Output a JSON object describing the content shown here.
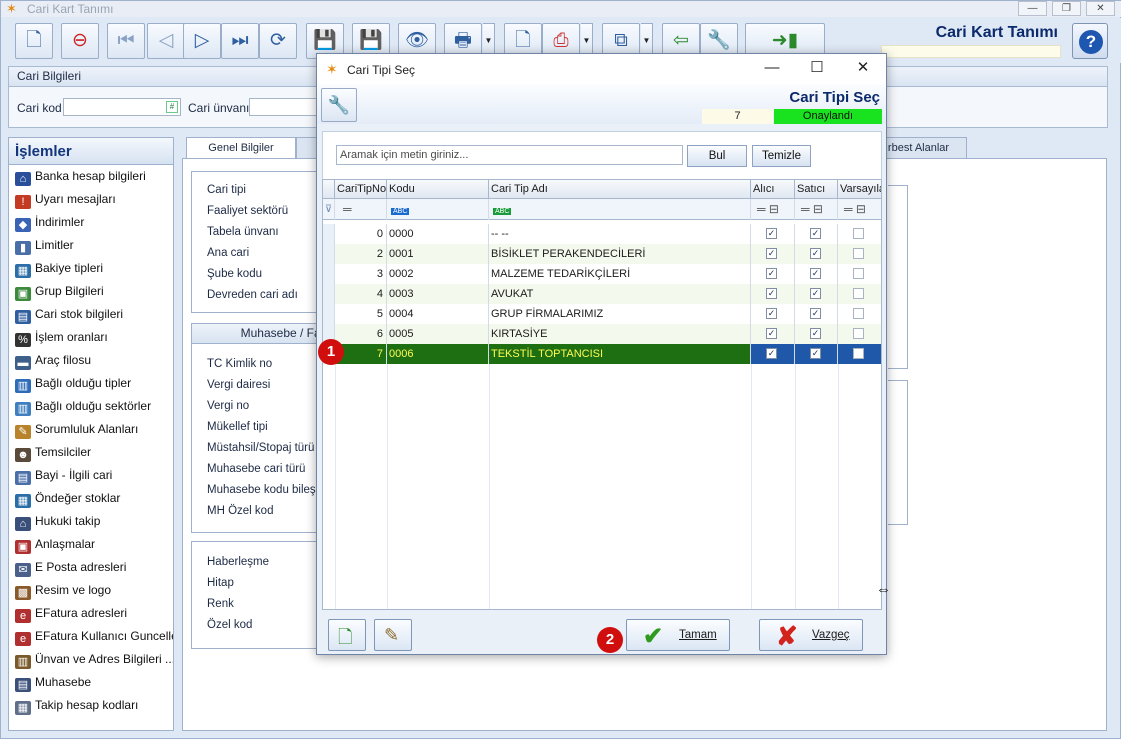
{
  "window": {
    "title": "Cari Kart Tanımı",
    "heading": "Cari Kart Tanımı"
  },
  "cari_bilgileri": {
    "group": "Cari Bilgileri",
    "kod_label": "Cari kod",
    "unvan_label": "Cari ünvanı"
  },
  "sidebar": {
    "title": "İşlemler",
    "items": [
      {
        "label": "Banka hesap bilgileri",
        "icon": "bank-icon"
      },
      {
        "label": "Uyarı mesajları",
        "icon": "warning-icon"
      },
      {
        "label": "İndirimler",
        "icon": "discount-icon"
      },
      {
        "label": "Limitler",
        "icon": "limit-icon"
      },
      {
        "label": "Bakiye tipleri",
        "icon": "calendar-icon"
      },
      {
        "label": "Grup Bilgileri",
        "icon": "group-icon"
      },
      {
        "label": "Cari stok bilgileri",
        "icon": "stock-icon"
      },
      {
        "label": "İşlem oranları",
        "icon": "percent-icon"
      },
      {
        "label": "Araç filosu",
        "icon": "vehicle-icon"
      },
      {
        "label": "Bağlı olduğu tipler",
        "icon": "type-icon"
      },
      {
        "label": "Bağlı olduğu sektörler",
        "icon": "sector-icon"
      },
      {
        "label": "Sorumluluk Alanları",
        "icon": "responsibility-icon"
      },
      {
        "label": "Temsilciler",
        "icon": "person-icon"
      },
      {
        "label": "Bayi - İlgili cari",
        "icon": "dealer-icon"
      },
      {
        "label": "Öndeğer stoklar",
        "icon": "default-stock-icon"
      },
      {
        "label": "Hukuki takip",
        "icon": "law-icon"
      },
      {
        "label": "Anlaşmalar",
        "icon": "agreement-icon"
      },
      {
        "label": "E Posta adresleri",
        "icon": "mail-icon"
      },
      {
        "label": "Resim ve logo",
        "icon": "image-icon"
      },
      {
        "label": "EFatura adresleri",
        "icon": "einvoice-icon"
      },
      {
        "label": "EFatura Kullanıcı Guncelle",
        "icon": "einvoice-update-icon"
      },
      {
        "label": "Ünvan ve Adres Bilgileri ...",
        "icon": "address-icon"
      },
      {
        "label": "Muhasebe",
        "icon": "accounting-icon"
      },
      {
        "label": "Takip hesap kodları",
        "icon": "tracking-icon"
      }
    ]
  },
  "tabs": {
    "genel": "Genel Bilgiler",
    "serbest": "rbest Alanlar"
  },
  "genel_fields": [
    "Cari tipi",
    "Faaliyet sektörü",
    "Tabela ünvanı",
    "Ana cari",
    "Şube kodu",
    "Devreden cari adı"
  ],
  "muhasebe": {
    "title": "Muhasebe / Fatura",
    "fields": [
      "TC Kimlik no",
      "Vergi dairesi",
      "Vergi no",
      "Mükellef tipi",
      "Müstahsil/Stopaj türü",
      "Muhasebe cari türü",
      "Muhasebe kodu bileşeni",
      "MH Özel kod"
    ]
  },
  "other_fields": [
    "Haberleşme",
    "Hitap",
    "Renk",
    "Özel kod"
  ],
  "dialog": {
    "title": "Cari Tipi Seç",
    "heading": "Cari Tipi Seç",
    "record_no": "7",
    "status": "Onaylandı",
    "search_placeholder": "Aramak için metin giriniz...",
    "find_button": "Bul",
    "clear_button": "Temizle",
    "columns": [
      "CariTipNo",
      "Kodu",
      "Cari Tip Adı",
      "Alıcı",
      "Satıcı",
      "Varsayıla"
    ],
    "rows": [
      {
        "no": "0",
        "code": "0000",
        "name": "-- --",
        "alici": true,
        "satici": true,
        "varsayilan": false
      },
      {
        "no": "2",
        "code": "0001",
        "name": "BİSİKLET PERAKENDECİLERİ",
        "alici": true,
        "satici": true,
        "varsayilan": false
      },
      {
        "no": "3",
        "code": "0002",
        "name": "MALZEME TEDARİKÇİLERİ",
        "alici": true,
        "satici": true,
        "varsayilan": false
      },
      {
        "no": "4",
        "code": "0003",
        "name": "AVUKAT",
        "alici": true,
        "satici": true,
        "varsayilan": false
      },
      {
        "no": "5",
        "code": "0004",
        "name": "GRUP FİRMALARIMIZ",
        "alici": true,
        "satici": true,
        "varsayilan": false
      },
      {
        "no": "6",
        "code": "0005",
        "name": "KIRTASİYE",
        "alici": true,
        "satici": true,
        "varsayilan": false
      },
      {
        "no": "7",
        "code": "0006",
        "name": "TEKSTİL TOPTANCISI",
        "alici": true,
        "satici": true,
        "varsayilan": false,
        "selected": true
      }
    ],
    "ok_button": "Tamam",
    "cancel_button": "Vazgeç"
  },
  "badges": [
    "1",
    "2"
  ],
  "colors": {
    "selected_row": "#1e6f12",
    "selected_text": "#fffc52",
    "status_ok": "#19e31f",
    "badge": "#d10e0e",
    "title_blue": "#0c2a6b"
  }
}
